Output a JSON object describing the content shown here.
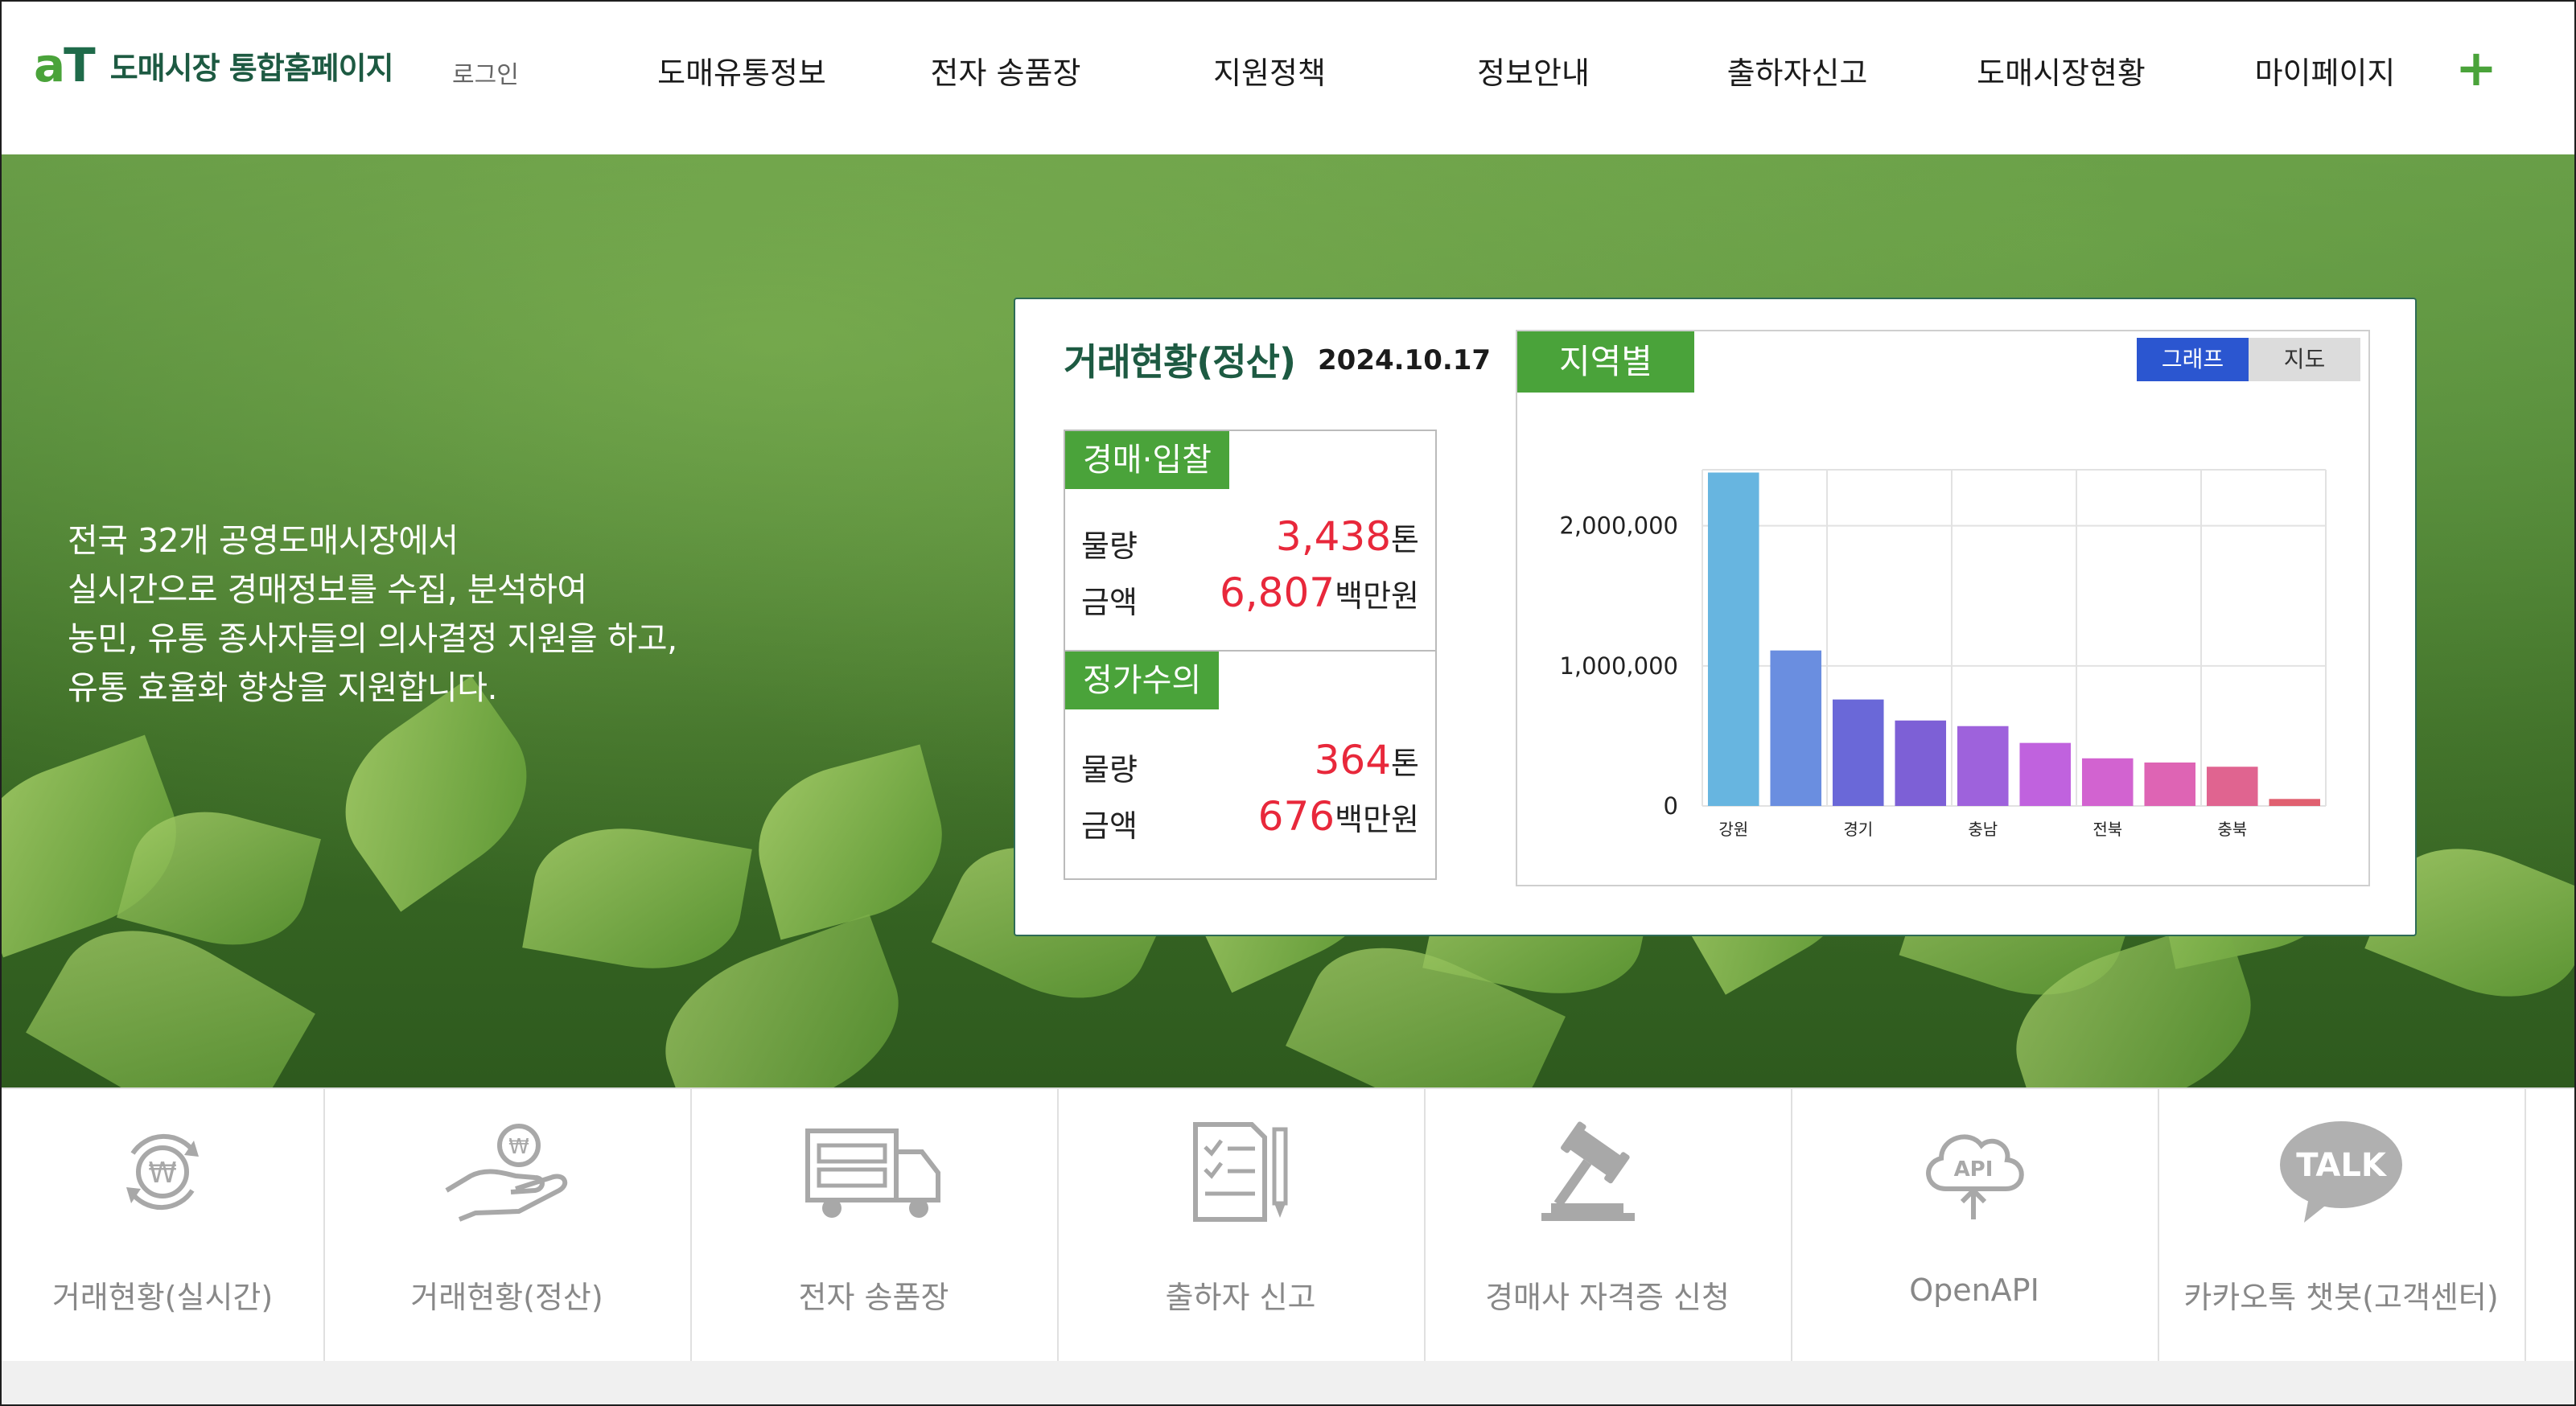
{
  "header": {
    "logo_mark_a": "a",
    "logo_mark_t": "T",
    "site_title": "도매시장 통합홈페이지",
    "login_label": "로그인",
    "nav": [
      {
        "label": "도매유통정보"
      },
      {
        "label": "전자 송품장"
      },
      {
        "label": "지원정책"
      },
      {
        "label": "정보안내"
      },
      {
        "label": "출하자신고"
      },
      {
        "label": "도매시장현황"
      },
      {
        "label": "마이페이지"
      }
    ],
    "plus_label": "+"
  },
  "hero": {
    "lines": [
      "전국 32개 공영도매시장에서",
      "실시간으로 경매정보를 수집, 분석하여",
      "농민, 유통 종사자들의 의사결정 지원을 하고,",
      "유통 효율화 향상을 지원합니다."
    ]
  },
  "stats": {
    "title": "거래현황(정산)",
    "date": "2024.10.17",
    "auction": {
      "tag": "경매·입찰",
      "volume_label": "물량",
      "volume_value": "3,438",
      "volume_unit": "톤",
      "amount_label": "금액",
      "amount_value": "6,807",
      "amount_unit": "백만원"
    },
    "fixed": {
      "tag": "정가수의",
      "volume_label": "물량",
      "volume_value": "364",
      "volume_unit": "톤",
      "amount_label": "금액",
      "amount_value": "676",
      "amount_unit": "백만원"
    },
    "region_tab": "지역별",
    "toggle_graph": "그래프",
    "toggle_map": "지도"
  },
  "chart_data": {
    "type": "bar",
    "categories": [
      "강원",
      "",
      "경기",
      "",
      "충남",
      "",
      "전북",
      "",
      "충북",
      ""
    ],
    "values": [
      2380000,
      1110000,
      760000,
      610000,
      570000,
      450000,
      340000,
      310000,
      280000,
      50000
    ],
    "colors": [
      "#67b5e0",
      "#6a8ee0",
      "#6a68d8",
      "#7d60d6",
      "#9e62dc",
      "#c062de",
      "#d263d0",
      "#de64b4",
      "#e06490",
      "#e06070"
    ],
    "ytick_labels": [
      "0",
      "1,000,000",
      "2,000,000"
    ],
    "ylim": [
      0,
      2400000
    ],
    "grid": true
  },
  "quick_menu": [
    {
      "label": "거래현황(실시간)",
      "icon": "won-refresh-icon"
    },
    {
      "label": "거래현황(정산)",
      "icon": "hand-coin-icon"
    },
    {
      "label": "전자 송품장",
      "icon": "truck-icon"
    },
    {
      "label": "출하자 신고",
      "icon": "checklist-pen-icon"
    },
    {
      "label": "경매사 자격증 신청",
      "icon": "gavel-icon"
    },
    {
      "label": "OpenAPI",
      "icon": "api-cloud-icon",
      "icon_text": "API"
    },
    {
      "label": "카카오톡 챗봇(고객센터)",
      "icon": "kakaotalk-icon",
      "icon_text": "TALK"
    }
  ]
}
